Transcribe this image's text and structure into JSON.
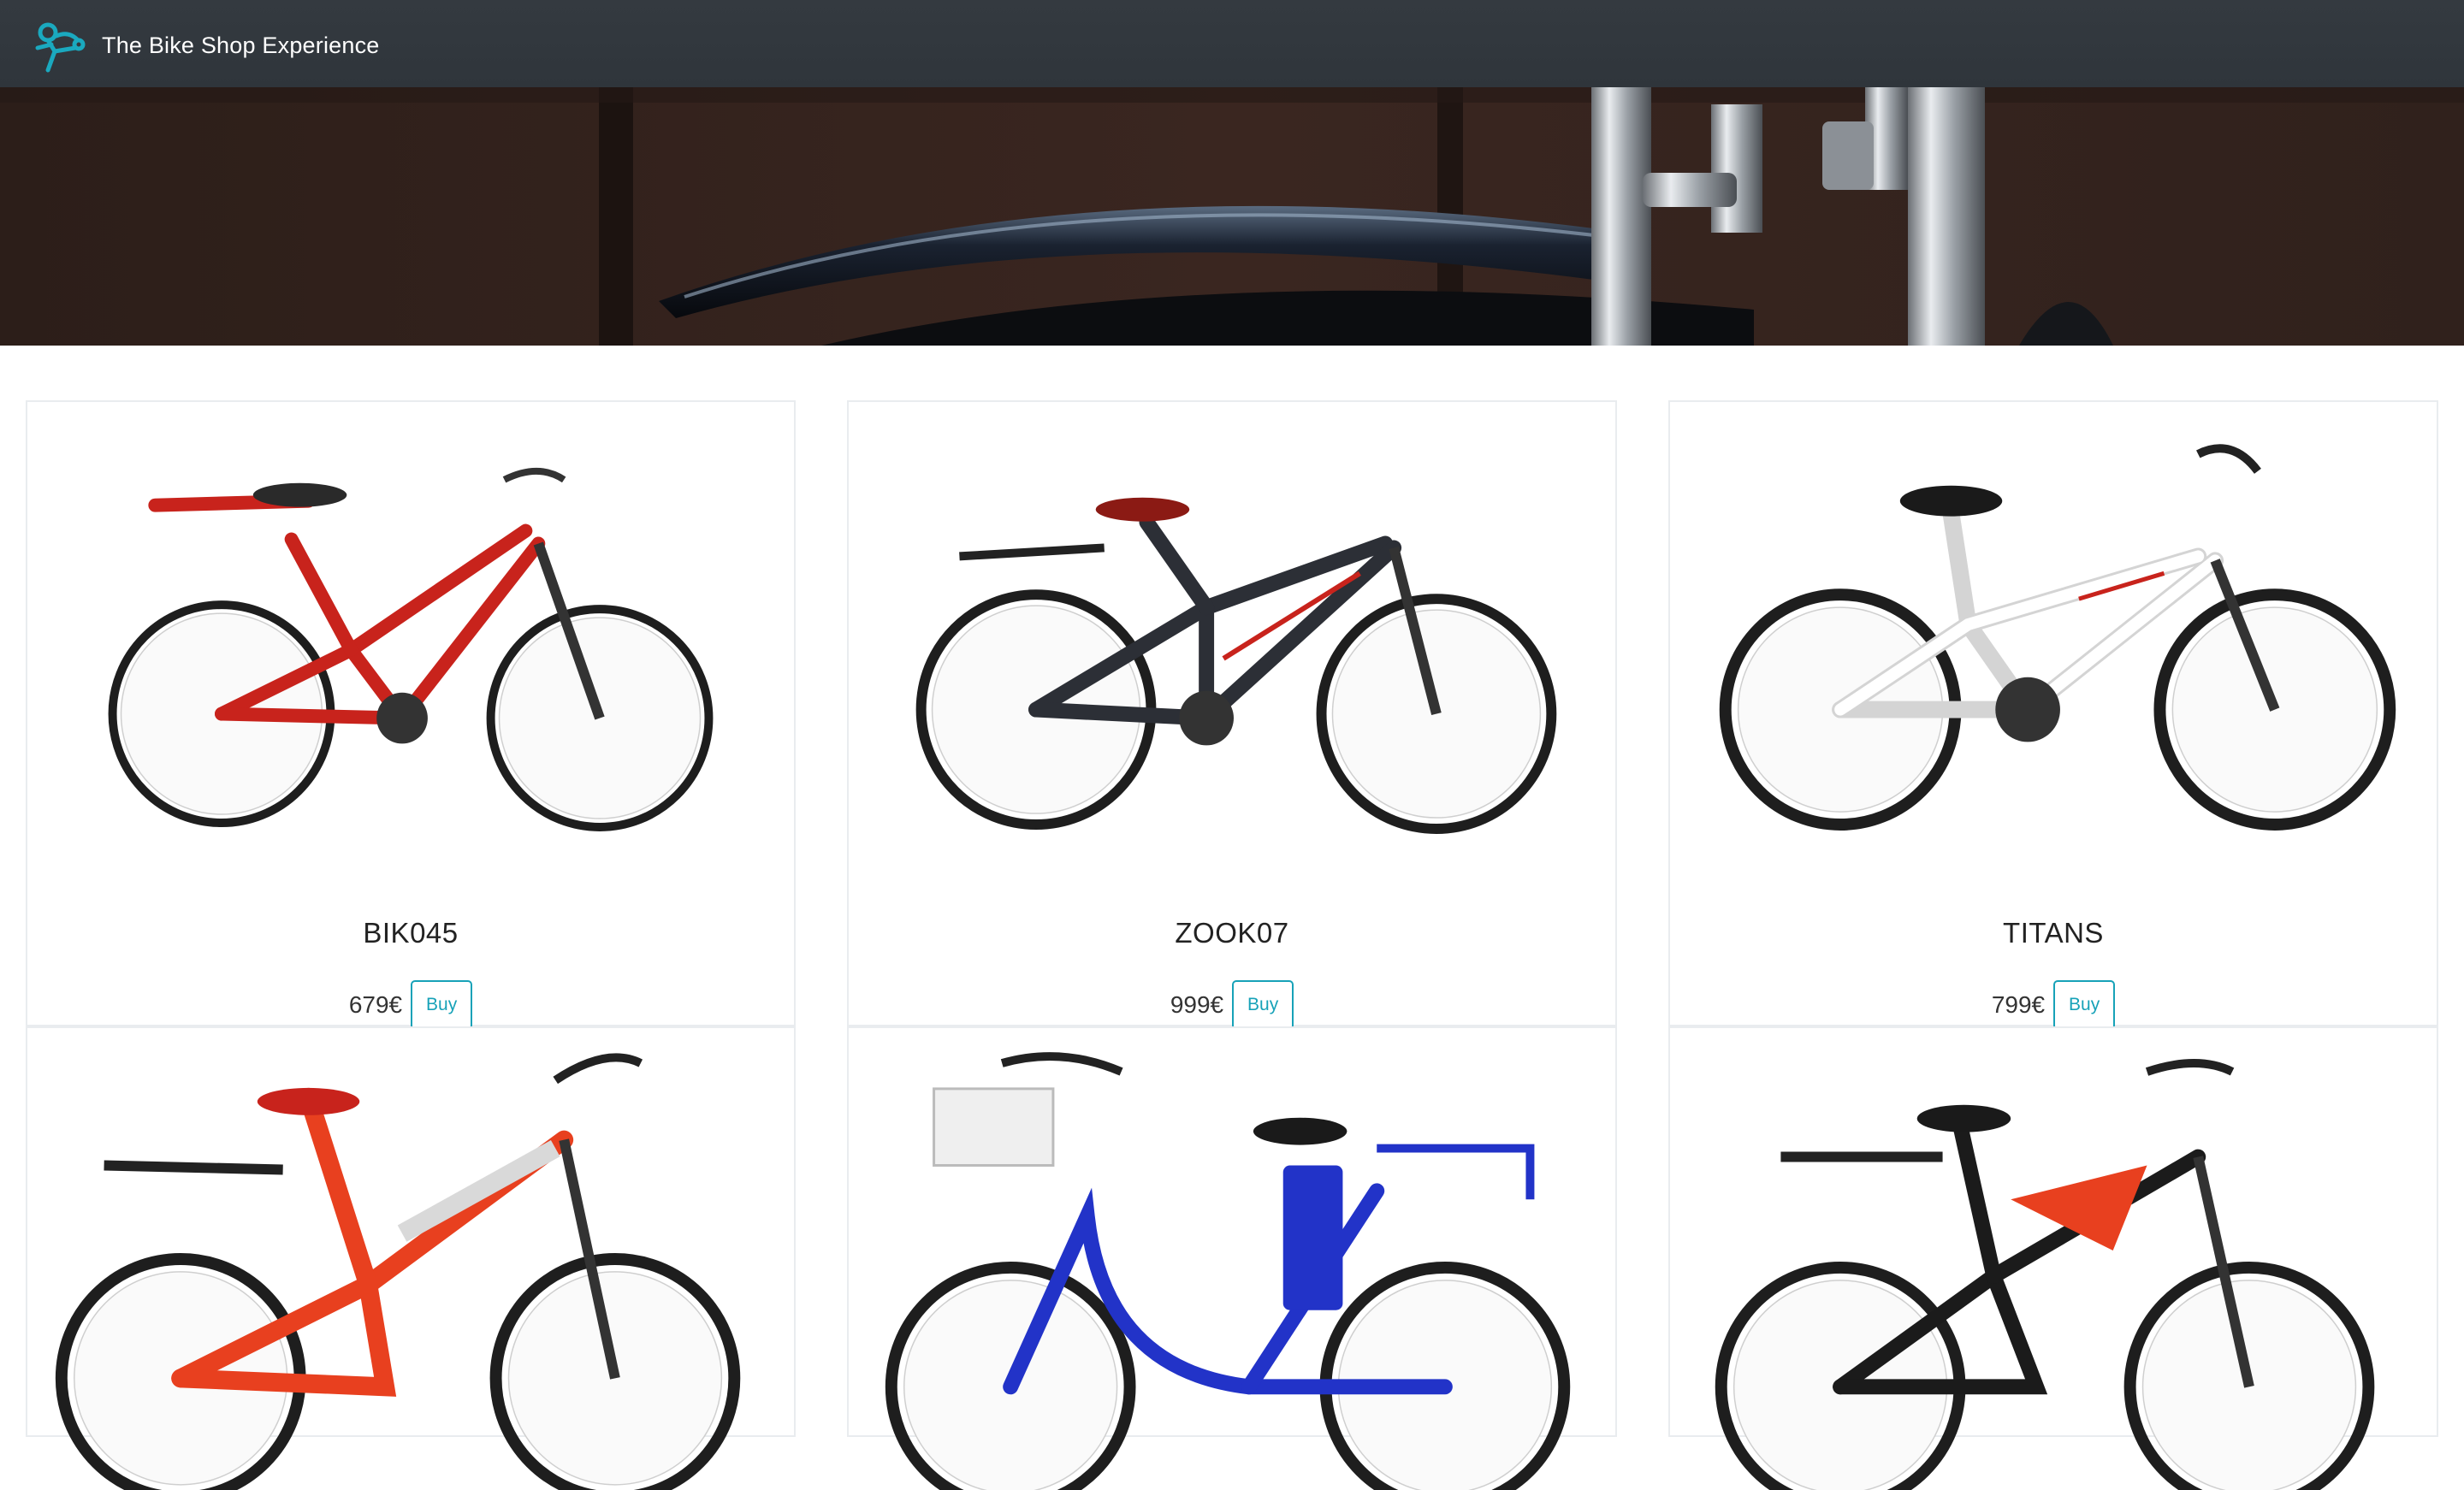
{
  "navbar": {
    "brand_name": "The Bike Shop Experience",
    "logo_icon": "cyclist-logo-icon",
    "logo_color": "#1aa9bf",
    "background": "#343a40"
  },
  "hero": {
    "image": "bicycle-fender-photo"
  },
  "products": [
    {
      "name": "BIK045",
      "price": "679€",
      "buy_label": "Buy",
      "frame_color": "#c8231c",
      "accent_color": "#ffffff"
    },
    {
      "name": "ZOOK07",
      "price": "999€",
      "buy_label": "Buy",
      "frame_color": "#2c2f36",
      "accent_color": "#c8231c"
    },
    {
      "name": "TITANS",
      "price": "799€",
      "buy_label": "Buy",
      "frame_color": "#f4f4f4",
      "accent_color": "#c8231c"
    },
    {
      "name": "",
      "price": "",
      "buy_label": "",
      "frame_color": "#e8401f",
      "accent_color": "#d9d9d9"
    },
    {
      "name": "",
      "price": "",
      "buy_label": "",
      "frame_color": "#2233c8",
      "accent_color": "#2233c8"
    },
    {
      "name": "",
      "price": "",
      "buy_label": "",
      "frame_color": "#e8401f",
      "accent_color": "#1b1b1b"
    }
  ],
  "colors": {
    "accent": "#17a2b8"
  }
}
